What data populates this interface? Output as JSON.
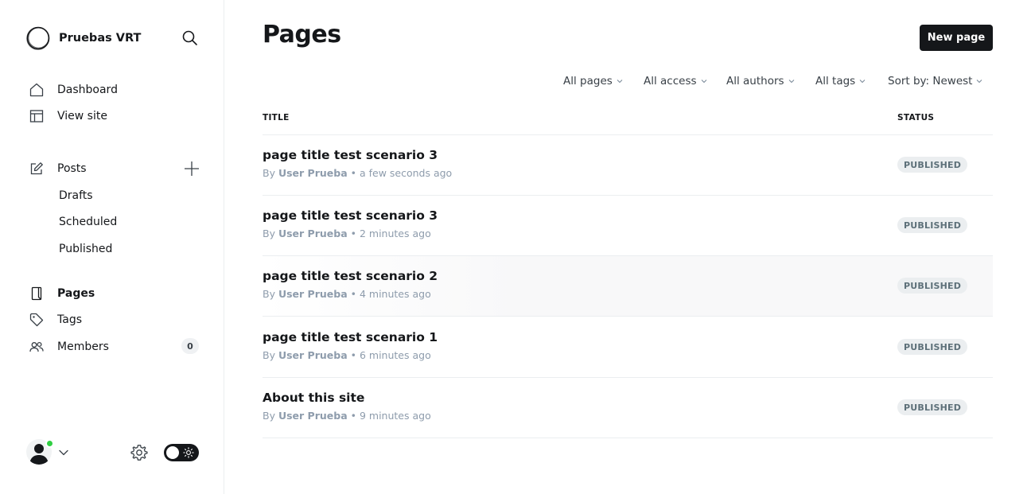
{
  "brand": {
    "name": "Pruebas VRT"
  },
  "nav": {
    "dashboard": "Dashboard",
    "view_site": "View site",
    "posts": "Posts",
    "drafts": "Drafts",
    "scheduled": "Scheduled",
    "published": "Published",
    "pages": "Pages",
    "tags": "Tags",
    "members": "Members",
    "members_count": "0"
  },
  "header": {
    "title": "Pages",
    "new_button": "New page"
  },
  "filters": {
    "type": "All pages",
    "access": "All access",
    "authors": "All authors",
    "tags": "All tags",
    "sort": "Sort by: Newest"
  },
  "table": {
    "col_title": "TITLE",
    "col_status": "STATUS",
    "rows": [
      {
        "title": "page title test scenario 3",
        "by": "By",
        "author": "User Prueba",
        "time": "• a few seconds ago",
        "status": "PUBLISHED"
      },
      {
        "title": "page title test scenario 3",
        "by": "By",
        "author": "User Prueba",
        "time": "• 2 minutes ago",
        "status": "PUBLISHED"
      },
      {
        "title": "page title test scenario 2",
        "by": "By",
        "author": "User Prueba",
        "time": "• 4 minutes ago",
        "status": "PUBLISHED"
      },
      {
        "title": "page title test scenario 1",
        "by": "By",
        "author": "User Prueba",
        "time": "• 6 minutes ago",
        "status": "PUBLISHED"
      },
      {
        "title": "About this site",
        "by": "By",
        "author": "User Prueba",
        "time": "• 9 minutes ago",
        "status": "PUBLISHED"
      }
    ]
  },
  "colors": {
    "accent_dark": "#15171a",
    "online": "#30cf43",
    "muted_text": "#8e9cac",
    "status_bg": "#ebeef0"
  },
  "icons": {
    "brand": "brand-ring-icon",
    "search": "search-icon",
    "dashboard": "home-icon",
    "view_site": "layout-icon",
    "posts": "edit-icon",
    "add_post": "plus-icon",
    "pages": "page-icon",
    "tags": "tag-icon",
    "members": "members-icon",
    "settings": "gear-icon",
    "theme": "sun-icon"
  }
}
